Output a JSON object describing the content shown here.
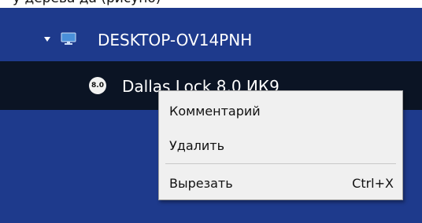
{
  "header": {
    "cut_text": "у дерева да (рисуно)"
  },
  "tree": {
    "computer": {
      "label": "DESKTOP-OV14PNH",
      "icon": "monitor-icon",
      "expanded": true
    },
    "product": {
      "label": "Dallas Lock 8.0 ИК9",
      "badge": "8.0",
      "selected": true
    }
  },
  "context_menu": {
    "comment_label": "Комментарий",
    "delete_label": "Удалить",
    "cut_label": "Вырезать",
    "cut_shortcut": "Ctrl+X"
  },
  "colors": {
    "panel_background": "#1e3a8c",
    "selected_row": "#0b1424",
    "menu_background": "#f0f0f0",
    "monitor_icon": "#4a90d9"
  }
}
